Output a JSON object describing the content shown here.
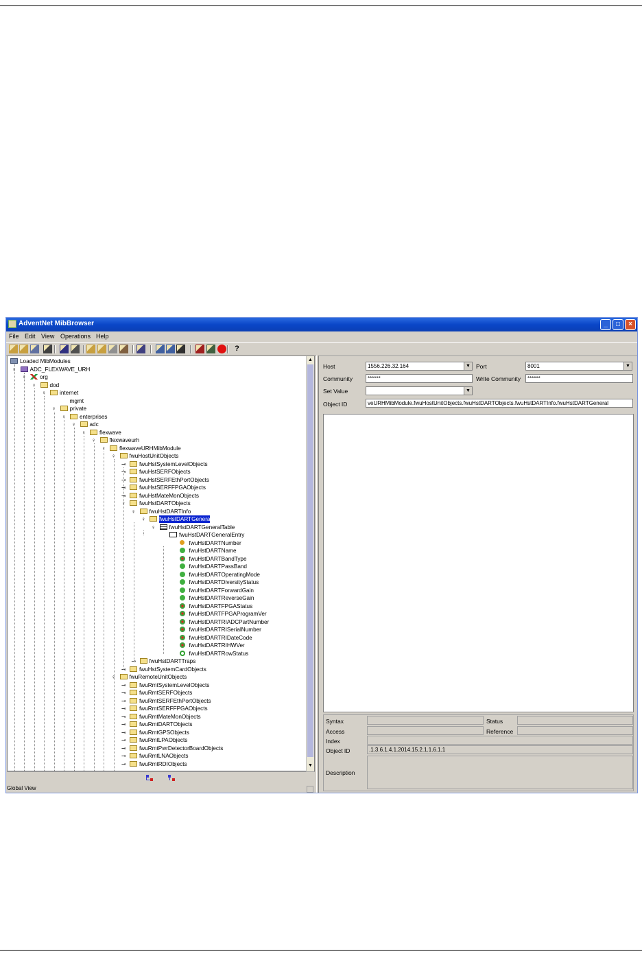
{
  "window": {
    "title": "AdventNet MibBrowser"
  },
  "menu": [
    "File",
    "Edit",
    "View",
    "Operations",
    "Help"
  ],
  "toolbar_icons": [
    "open-folder-icon",
    "open-mib-icon",
    "load-icon",
    "find-icon",
    "save-icon",
    "print-icon",
    "copy-icon",
    "paste-icon",
    "delete-icon",
    "settings-icon",
    "table-icon",
    "trap-icon",
    "graph-icon",
    "grid-icon",
    "debug-icon",
    "edit-icon",
    "stop-icon",
    "help-icon"
  ],
  "help_glyph": "?",
  "tree": [
    {
      "label": "Loaded MibModules",
      "level": 0,
      "icon": "modules"
    },
    {
      "label": "ADC_FLEXWAVE_URH",
      "level": 1,
      "icon": "module"
    },
    {
      "label": "org",
      "level": 2,
      "icon": "root"
    },
    {
      "label": "dod",
      "level": 3,
      "icon": "folder"
    },
    {
      "label": "internet",
      "level": 4,
      "icon": "folder"
    },
    {
      "label": "mgmt",
      "level": 5,
      "icon": "none"
    },
    {
      "label": "private",
      "level": 5,
      "icon": "folder"
    },
    {
      "label": "enterprises",
      "level": 6,
      "icon": "folder"
    },
    {
      "label": "adc",
      "level": 7,
      "icon": "folder"
    },
    {
      "label": "flexwave",
      "level": 8,
      "icon": "folder"
    },
    {
      "label": "flexwaveurh",
      "level": 9,
      "icon": "folder"
    },
    {
      "label": "flexwaveURHMibModule",
      "level": 10,
      "icon": "folder"
    },
    {
      "label": "fwuHostUnitObjects",
      "level": 11,
      "icon": "folder"
    },
    {
      "label": "fwuHstSystemLevelObjects",
      "level": 12,
      "icon": "folder"
    },
    {
      "label": "fwuHstSERFObjects",
      "level": 12,
      "icon": "folder"
    },
    {
      "label": "fwuHstSERFEthPortObjects",
      "level": 12,
      "icon": "folder"
    },
    {
      "label": "fwuHstSERFFPGAObjects",
      "level": 12,
      "icon": "folder"
    },
    {
      "label": "fwuHstMateMonObjects",
      "level": 12,
      "icon": "folder"
    },
    {
      "label": "fwuHstDARTObjects",
      "level": 12,
      "icon": "folder"
    },
    {
      "label": "fwuHstDARTInfo",
      "level": 13,
      "icon": "folder"
    },
    {
      "label": "fwuHstDARTGenera",
      "level": 14,
      "icon": "folder",
      "selected": true
    },
    {
      "label": "fwuHstDARTGeneralTable",
      "level": 15,
      "icon": "table"
    },
    {
      "label": "fwuHstDARTGeneralEntry",
      "level": 16,
      "icon": "entry"
    },
    {
      "label": "fwuHstDARTNumber",
      "level": 17,
      "icon": "key"
    },
    {
      "label": "fwuHstDARTName",
      "level": 17,
      "icon": "rw"
    },
    {
      "label": "fwuHstDARTBandType",
      "level": 17,
      "icon": "ro"
    },
    {
      "label": "fwuHstDARTPassBand",
      "level": 17,
      "icon": "rw"
    },
    {
      "label": "fwuHstDARTOperatingMode",
      "level": 17,
      "icon": "rw"
    },
    {
      "label": "fwuHstDARTDiversityStatus",
      "level": 17,
      "icon": "rw"
    },
    {
      "label": "fwuHstDARTForwardGain",
      "level": 17,
      "icon": "rw"
    },
    {
      "label": "fwuHstDARTReverseGain",
      "level": 17,
      "icon": "rw"
    },
    {
      "label": "fwuHstDARTFPGAStatus",
      "level": 17,
      "icon": "ro"
    },
    {
      "label": "fwuHstDARTFPGAProgramVer",
      "level": 17,
      "icon": "ro"
    },
    {
      "label": "fwuHstDARTRIADCPartNumber",
      "level": 17,
      "icon": "ro"
    },
    {
      "label": "fwuHstDARTRISerialNumber",
      "level": 17,
      "icon": "ro"
    },
    {
      "label": "fwuHstDARTRIDateCode",
      "level": 17,
      "icon": "ro"
    },
    {
      "label": "fwuHstDARTRIHWVer",
      "level": 17,
      "icon": "ro"
    },
    {
      "label": "fwuHstDARTRowStatus",
      "level": 17,
      "icon": "rc"
    },
    {
      "label": "fwuHstDARTTraps",
      "level": 13,
      "icon": "folder"
    },
    {
      "label": "fwuHstSystemCardObjects",
      "level": 12,
      "icon": "folder"
    },
    {
      "label": "fwuRemoteUnitObjects",
      "level": 11,
      "icon": "folder"
    },
    {
      "label": "fwuRmtSystemLevelObjects",
      "level": 12,
      "icon": "folder"
    },
    {
      "label": "fwuRmtSERFObjects",
      "level": 12,
      "icon": "folder"
    },
    {
      "label": "fwuRmtSERFEthPortObjects",
      "level": 12,
      "icon": "folder"
    },
    {
      "label": "fwuRmtSERFFPGAObjects",
      "level": 12,
      "icon": "folder"
    },
    {
      "label": "fwuRmtMateMonObjects",
      "level": 12,
      "icon": "folder"
    },
    {
      "label": "fwuRmtDARTObjects",
      "level": 12,
      "icon": "folder"
    },
    {
      "label": "fwuRmtGPSObjects",
      "level": 12,
      "icon": "folder"
    },
    {
      "label": "fwuRmtLPAObjects",
      "level": 12,
      "icon": "folder"
    },
    {
      "label": "fwuRmtPwrDetectorBoardObjects",
      "level": 12,
      "icon": "folder"
    },
    {
      "label": "fwuRmtLNAObjects",
      "level": 12,
      "icon": "folder"
    },
    {
      "label": "fwuRmtRDIObjects",
      "level": 12,
      "icon": "folder"
    }
  ],
  "status_bar": {
    "text": "Global View"
  },
  "connection": {
    "host_label": "Host",
    "host_value": "1556.226.32.164",
    "port_label": "Port",
    "port_value": "8001",
    "community_label": "Community",
    "community_value": "******",
    "write_community_label": "Write Community",
    "write_community_value": "******",
    "set_value_label": "Set Value",
    "set_value_value": "",
    "object_id_label": "Object ID",
    "object_id_value": "veURHMibModule.fwuHostUnitObjects.fwuHstDARTObjects.fwuHstDARTInfo.fwuHstDARTGeneral"
  },
  "properties": {
    "syntax_label": "Syntax",
    "syntax_value": "",
    "status_label": "Status",
    "status_value": "",
    "access_label": "Access",
    "access_value": "",
    "reference_label": "Reference",
    "reference_value": "",
    "index_label": "Index",
    "index_value": "",
    "object_id_label": "Object ID",
    "object_id_value": ".1.3.6.1.4.1.2014.15.2.1.1.6.1.1",
    "description_label": "Description",
    "description_value": ""
  }
}
